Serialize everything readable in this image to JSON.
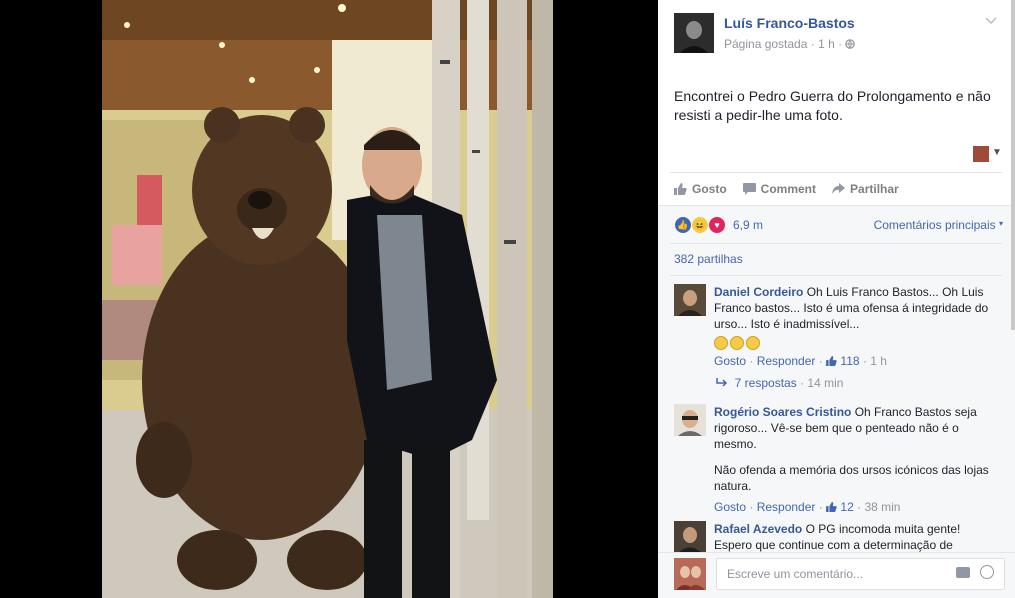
{
  "header": {
    "page_name": "Luís Franco-Bastos",
    "meta_liked": "Página gostada",
    "meta_time": "1 h"
  },
  "post": {
    "text": "Encontrei o Pedro Guerra do Prolongamento e não resisti a pedir-lhe uma foto."
  },
  "actions": {
    "like": "Gosto",
    "comment": "Comment",
    "share": "Partilhar"
  },
  "reactions": {
    "count": "6,9 m",
    "sort_label": "Comentários principais",
    "shares": "382 partilhas"
  },
  "comments": [
    {
      "author": "Daniel Cordeiro",
      "text": "Oh Luis Franco Bastos... Oh Luis Franco bastos... Isto é uma ofensa á integridade do urso... Isto é inadmissível...",
      "like_label": "Gosto",
      "reply_label": "Responder",
      "likes": "118",
      "time": "1 h",
      "replies": "7 respostas",
      "replies_time": "14 min"
    },
    {
      "author": "Rogério Soares Cristino",
      "text": "Oh Franco Bastos seja rigoroso... Vê-se bem que o penteado não é o mesmo.",
      "text2": "Não ofenda a memória dos ursos icónicos das lojas natura.",
      "like_label": "Gosto",
      "reply_label": "Responder",
      "likes": "12",
      "time": "38 min"
    },
    {
      "author": "Rafael Azevedo",
      "text": "O PG incomoda muita gente! Espero que continue com a determinação de"
    }
  ],
  "composer": {
    "placeholder": "Escreve um comentário..."
  },
  "colors": {
    "link_blue": "#365899",
    "accent_blue": "#4267b2",
    "muted": "#90949c"
  }
}
